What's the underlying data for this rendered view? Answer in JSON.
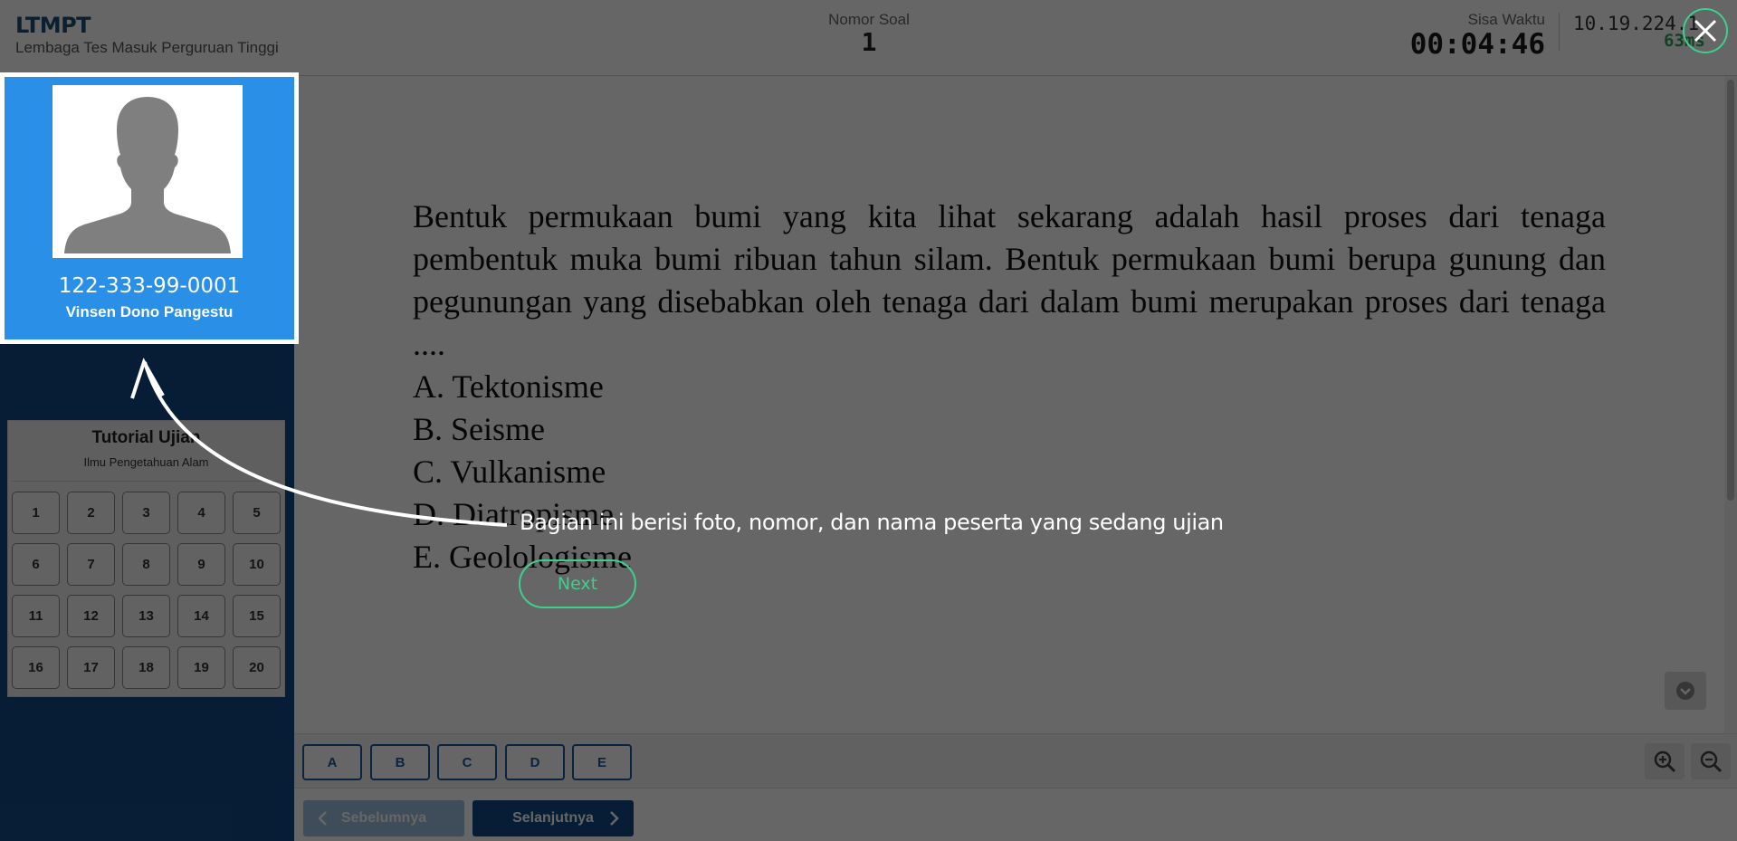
{
  "header": {
    "brand_title": "LTMPT",
    "brand_subtitle": "Lembaga Tes Masuk Perguruan Tinggi",
    "question_number_label": "Nomor Soal",
    "question_number": "1",
    "timer_label": "Sisa Waktu",
    "timer_value": "00:04:46",
    "ip_address": "10.19.224.1",
    "ping": "63ms"
  },
  "profile": {
    "participant_number": "122-333-99-0001",
    "participant_name": "Vinsen Dono Pangestu"
  },
  "navigator": {
    "title": "Tutorial Ujian",
    "subject": "Ilmu Pengetahuan Alam",
    "questions": [
      "1",
      "2",
      "3",
      "4",
      "5",
      "6",
      "7",
      "8",
      "9",
      "10",
      "11",
      "12",
      "13",
      "14",
      "15",
      "16",
      "17",
      "18",
      "19",
      "20"
    ]
  },
  "question": {
    "text": "Bentuk permukaan bumi yang kita lihat sekarang adalah hasil proses dari tenaga pembentuk muka bumi ribuan tahun silam. Bentuk permukaan bumi berupa gunung dan pegunungan yang disebabkan oleh tenaga dari dalam bumi merupakan proses dari tenaga ....",
    "options": [
      "A. Tektonisme",
      "B. Seisme",
      "C. Vulkanisme",
      "D. Diatropisme",
      "E. Geolologisme"
    ]
  },
  "answer_buttons": [
    "A",
    "B",
    "C",
    "D",
    "E"
  ],
  "navigation": {
    "prev_label": "Sebelumnya",
    "next_label": "Selanjutnya"
  },
  "tutorial": {
    "message": "Bagian ini berisi foto, nomor, dan nama peserta yang sedang ujian",
    "next_label": "Next"
  },
  "colors": {
    "primary": "#124a86",
    "profile_bg": "#2a8fe6",
    "ping_green": "#2aa860",
    "tour_accent": "#3ecf8e"
  }
}
